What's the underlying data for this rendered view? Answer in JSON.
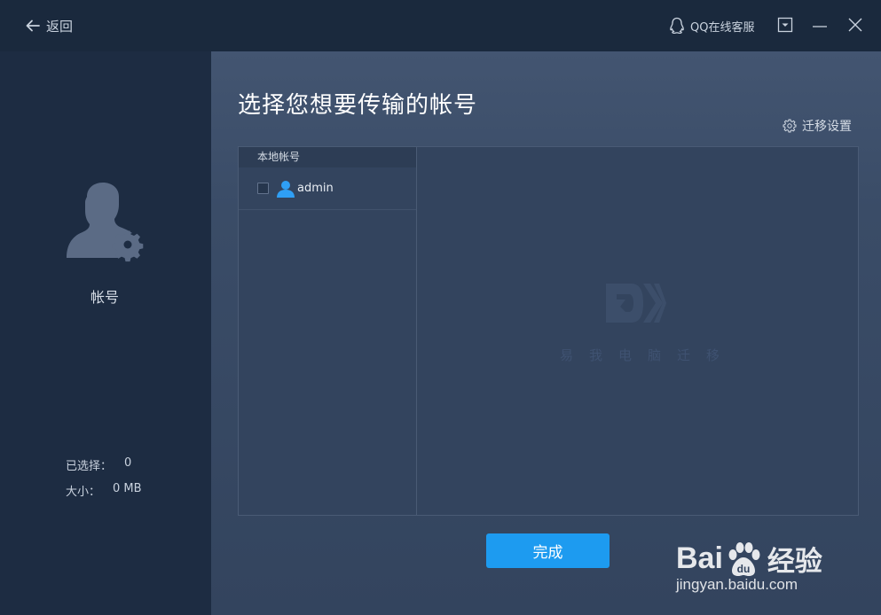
{
  "titlebar": {
    "back_label": "返回",
    "qq_service_label": "QQ在线客服"
  },
  "sidebar": {
    "section_label": "帐号",
    "selected_label": "已选择：",
    "selected_value": "0",
    "size_label": "大小：",
    "size_value": "0 MB"
  },
  "main": {
    "title": "选择您想要传输的帐号",
    "migrate_settings_label": "迁移设置",
    "list_header": "本地帐号",
    "accounts": [
      {
        "name": "admin",
        "checked": false
      }
    ],
    "watermark_chars": [
      "易",
      "我",
      "电",
      "脑",
      "迁",
      "移"
    ],
    "finish_label": "完成"
  },
  "watermark": {
    "brand_left": "Bai",
    "brand_mid": "du",
    "brand_right": "经验",
    "url": "jingyan.baidu.com"
  },
  "colors": {
    "accent": "#1d9bf0",
    "titlebar_bg": "#1a293d",
    "sidebar_bg": "#1d2c42",
    "panel_bg": "#33445e"
  }
}
